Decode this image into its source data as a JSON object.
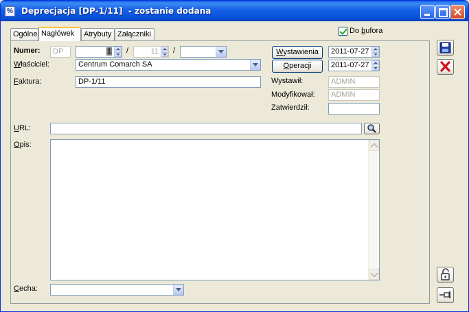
{
  "window": {
    "title": "Deprecjacja [DP-1/11]  - zostanie dodana"
  },
  "tabs": [
    {
      "label": "Ogólne"
    },
    {
      "label": "Nagłówek"
    },
    {
      "label": "Atrybuty"
    },
    {
      "label": "Załączniki"
    }
  ],
  "do_bufora": {
    "label_pre": "Do ",
    "label_u": "b",
    "label_post": "ufora",
    "checked": true
  },
  "numer": {
    "label": "Numer:",
    "prefix": "DP",
    "number": "1",
    "sep1": "/",
    "year": "11",
    "sep2": "/",
    "series": ""
  },
  "wlasciciel": {
    "label": "Właściciel:",
    "value": "Centrum Comarch SA"
  },
  "faktura": {
    "label": "Faktura:",
    "value": "DP-1/11"
  },
  "dates": {
    "wystawienia_label": "Wystawienia",
    "wystawienia_value": "2011-07-27",
    "operacji_label": "Operacji",
    "operacji_value": "2011-07-27"
  },
  "audit": {
    "wystawil_label": "Wystawił:",
    "wystawil_value": "ADMIN",
    "modyfikowal_label": "Modyfikował:",
    "modyfikowal_value": "ADMIN",
    "zatwierdzil_label": "Zatwierdził:",
    "zatwierdzil_value": ""
  },
  "url": {
    "label": "URL:",
    "value": ""
  },
  "opis": {
    "label": "Opis:",
    "value": ""
  },
  "cecha": {
    "label": "Cecha:",
    "value": ""
  },
  "colors": {
    "titlebar": "#0a5ce8",
    "window_bg": "#ece9d8",
    "tab_highlight": "#ffc73c",
    "close_red": "#d44a23"
  },
  "icons": {
    "save": "floppy-disk-icon",
    "cancel": "red-x-icon",
    "lock": "padlock-icon",
    "pin": "pushpin-icon",
    "search": "magnifier-icon"
  }
}
